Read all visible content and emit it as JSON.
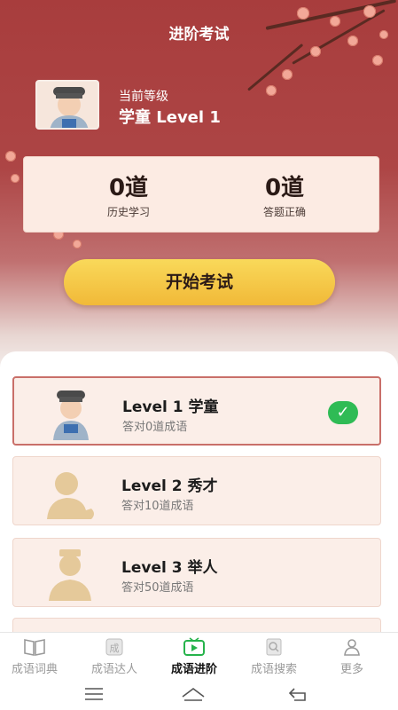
{
  "header": {
    "title": "进阶考试"
  },
  "current": {
    "label": "当前等级",
    "level": "学童 Level 1"
  },
  "stats": [
    {
      "value": "0道",
      "label": "历史学习"
    },
    {
      "value": "0道",
      "label": "答题正确"
    }
  ],
  "start_button": "开始考试",
  "levels": [
    {
      "title": "Level 1 学童",
      "subtitle": "答对0道成语",
      "completed": true
    },
    {
      "title": "Level 2 秀才",
      "subtitle": "答对10道成语",
      "completed": false
    },
    {
      "title": "Level 3 举人",
      "subtitle": "答对50道成语",
      "completed": false
    }
  ],
  "tabs": [
    {
      "label": "成语词典",
      "icon": "book-icon"
    },
    {
      "label": "成语达人",
      "icon": "badge-icon"
    },
    {
      "label": "成语进阶",
      "icon": "tv-play-icon",
      "active": true
    },
    {
      "label": "成语搜索",
      "icon": "search-book-icon"
    },
    {
      "label": "更多",
      "icon": "person-icon"
    }
  ],
  "colors": {
    "header_bg": "#a83d3d",
    "button": "#f5c442",
    "check": "#2fbb55"
  }
}
